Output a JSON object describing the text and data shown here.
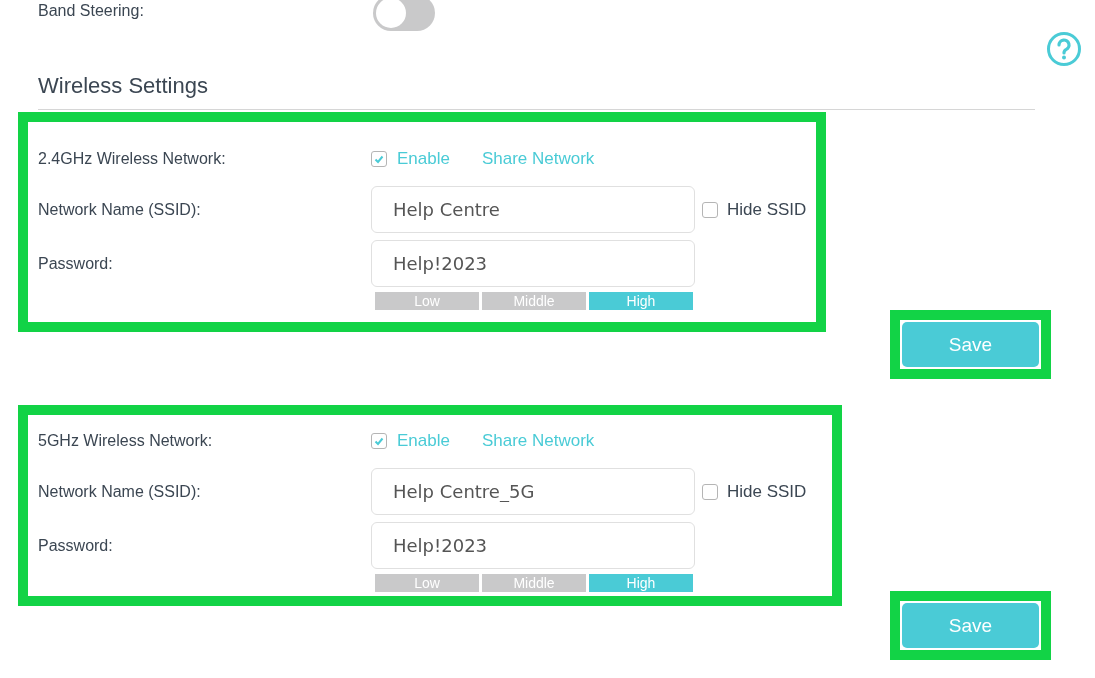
{
  "band_steering": {
    "label": "Band Steering:",
    "on": false
  },
  "section_title": "Wireless Settings",
  "networks": [
    {
      "label": "2.4GHz Wireless Network:",
      "enabled": true,
      "enable_label": "Enable",
      "share_label": "Share Network",
      "ssid_label": "Network Name (SSID):",
      "ssid": "Help Centre",
      "hide_ssid_label": "Hide SSID",
      "hide_ssid": false,
      "password_label": "Password:",
      "password": "Help!2023",
      "strength": [
        {
          "label": "Low",
          "selected": false
        },
        {
          "label": "Middle",
          "selected": false
        },
        {
          "label": "High",
          "selected": true
        }
      ],
      "save_label": "Save"
    },
    {
      "label": "5GHz Wireless Network:",
      "enabled": true,
      "enable_label": "Enable",
      "share_label": "Share Network",
      "ssid_label": "Network Name (SSID):",
      "ssid": "Help Centre_5G",
      "hide_ssid_label": "Hide SSID",
      "hide_ssid": false,
      "password_label": "Password:",
      "password": "Help!2023",
      "strength": [
        {
          "label": "Low",
          "selected": false
        },
        {
          "label": "Middle",
          "selected": false
        },
        {
          "label": "High",
          "selected": true
        }
      ],
      "save_label": "Save"
    }
  ]
}
